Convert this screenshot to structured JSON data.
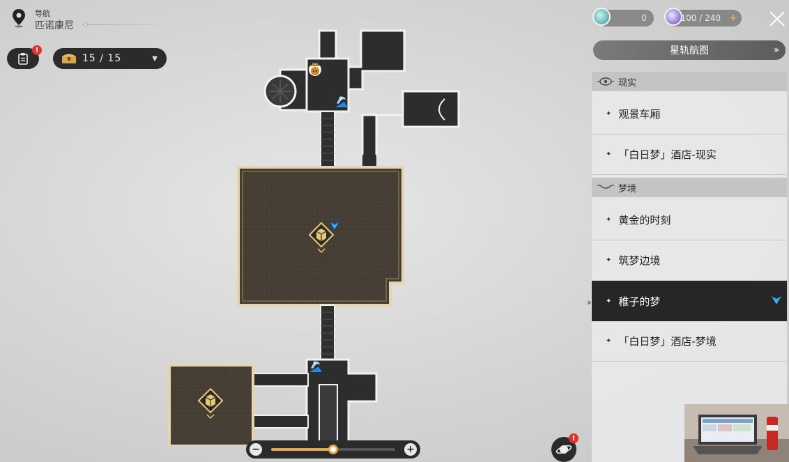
{
  "nav": {
    "title": "导航",
    "region": "匹诺康尼",
    "mission_alert": "!",
    "chest_counter": "15 / 15"
  },
  "currency": {
    "primary_value": "0",
    "power_value": "100 / 240",
    "plus": "+"
  },
  "panel": {
    "star_rail_map_label": "星轨航图",
    "sections": [
      {
        "name": "现实",
        "items": [
          {
            "label": "观景车厢"
          },
          {
            "label": "「白日梦」酒店-现实"
          }
        ]
      },
      {
        "name": "梦境",
        "items": [
          {
            "label": "黄金的时刻"
          },
          {
            "label": "筑梦边境"
          },
          {
            "label": "稚子的梦",
            "selected": true
          },
          {
            "label": "「白日梦」酒店-梦境"
          }
        ]
      }
    ]
  },
  "zoom": {
    "minus": "−",
    "plus": "+",
    "level": 0.5
  },
  "planet_alert": "!",
  "colors": {
    "accent_gold": "#e8a64a",
    "selected_row": "#262626",
    "teleport_cyan": "#29b6f6",
    "alert_red": "#e03030"
  }
}
